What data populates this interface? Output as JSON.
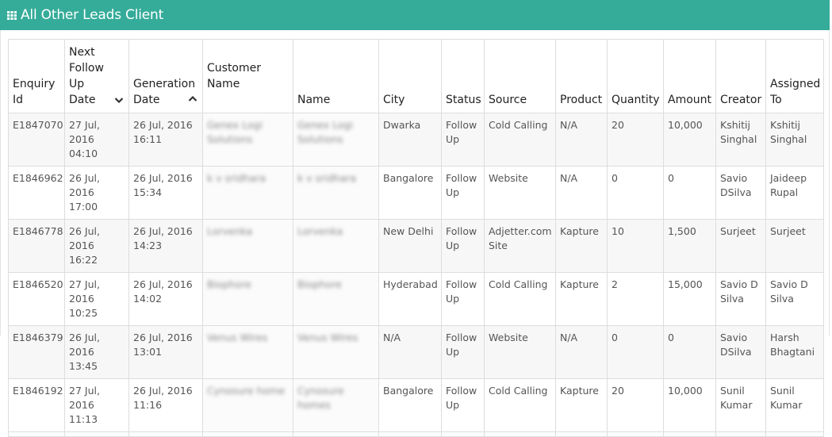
{
  "header": {
    "title": "All Other Leads Client",
    "icon": "table-grid-icon",
    "bg_color": "#35ac99"
  },
  "table": {
    "columns": [
      {
        "key": "enquiry_id",
        "label": "Enquiry Id"
      },
      {
        "key": "next_follow_up",
        "label": "Next Follow Up Date",
        "sort": "chevron-down-icon"
      },
      {
        "key": "generation_date",
        "label": "Generation Date",
        "sort": "chevron-up-icon"
      },
      {
        "key": "customer_name",
        "label": "Customer Name"
      },
      {
        "key": "name",
        "label": "Name"
      },
      {
        "key": "city",
        "label": "City"
      },
      {
        "key": "status",
        "label": "Status"
      },
      {
        "key": "source",
        "label": "Source"
      },
      {
        "key": "product",
        "label": "Product"
      },
      {
        "key": "quantity",
        "label": "Quantity"
      },
      {
        "key": "amount",
        "label": "Amount"
      },
      {
        "key": "creator",
        "label": "Creator"
      },
      {
        "key": "assigned_to",
        "label": "Assigned To"
      }
    ],
    "rows": [
      {
        "enquiry_id": "E1847070",
        "next_follow_up": "27 Jul, 2016 04:10",
        "generation_date": "26 Jul, 2016 16:11",
        "customer_name": "Genex Logi Solutions",
        "name": "Genex Logi Solutions",
        "city": "Dwarka",
        "status": "Follow Up",
        "source": "Cold Calling",
        "product": "N/A",
        "quantity": "20",
        "amount": "10,000",
        "creator": "Kshitij Singhal",
        "assigned_to": "Kshitij Singhal"
      },
      {
        "enquiry_id": "E1846962",
        "next_follow_up": "26 Jul, 2016 17:00",
        "generation_date": "26 Jul, 2016 15:34",
        "customer_name": "k v sridhara",
        "name": "k v sridhara",
        "city": "Bangalore",
        "status": "Follow Up",
        "source": "Website",
        "product": "N/A",
        "quantity": "0",
        "amount": "0",
        "creator": "Savio DSilva",
        "assigned_to": "Jaideep Rupal"
      },
      {
        "enquiry_id": "E1846778",
        "next_follow_up": "26 Jul, 2016 16:22",
        "generation_date": "26 Jul, 2016 14:23",
        "customer_name": "Lorvenka",
        "name": "Lorvenka",
        "city": "New Delhi",
        "status": "Follow Up",
        "source": "Adjetter.com Site",
        "product": "Kapture",
        "quantity": "10",
        "amount": "1,500",
        "creator": "Surjeet",
        "assigned_to": "Surjeet"
      },
      {
        "enquiry_id": "E1846520",
        "next_follow_up": "27 Jul, 2016 10:25",
        "generation_date": "26 Jul, 2016 14:02",
        "customer_name": "Biophore",
        "name": "Biophore",
        "city": "Hyderabad",
        "status": "Follow Up",
        "source": "Cold Calling",
        "product": "Kapture",
        "quantity": "2",
        "amount": "15,000",
        "creator": "Savio D Silva",
        "assigned_to": "Savio D Silva"
      },
      {
        "enquiry_id": "E1846379",
        "next_follow_up": "26 Jul, 2016 13:45",
        "generation_date": "26 Jul, 2016 13:01",
        "customer_name": "Venus Wires",
        "name": "Venus Wires",
        "city": "N/A",
        "status": "Follow Up",
        "source": "Website",
        "product": "N/A",
        "quantity": "0",
        "amount": "0",
        "creator": "Savio DSilva",
        "assigned_to": "Harsh Bhagtani"
      },
      {
        "enquiry_id": "E1846192",
        "next_follow_up": "27 Jul, 2016 11:13",
        "generation_date": "26 Jul, 2016 11:16",
        "customer_name": "Cynosure home",
        "name": "Cynosure homes",
        "city": "Bangalore",
        "status": "Follow Up",
        "source": "Cold Calling",
        "product": "Kapture",
        "quantity": "20",
        "amount": "10,000",
        "creator": "Sunil Kumar",
        "assigned_to": "Sunil Kumar"
      }
    ]
  }
}
